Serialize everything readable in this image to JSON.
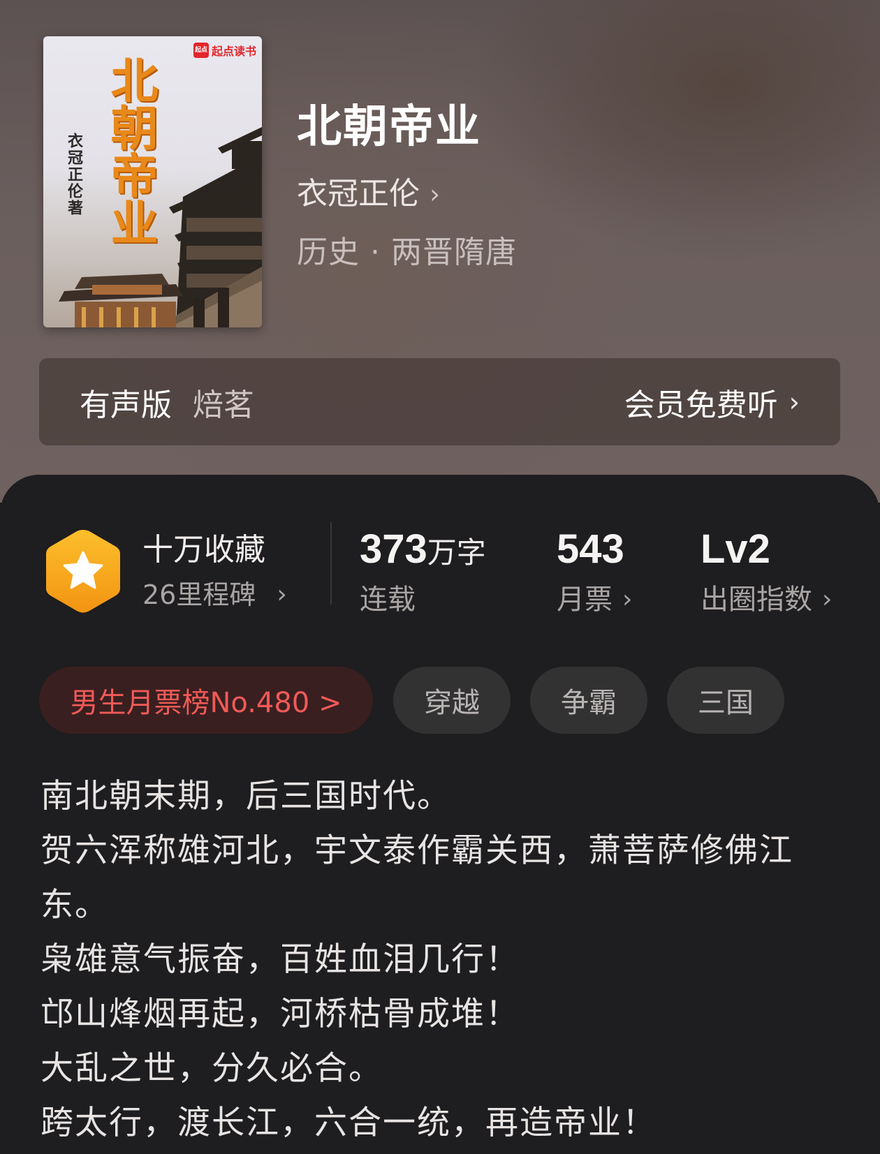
{
  "cover": {
    "publisher": "起点读书",
    "publisher_mark": "起点",
    "title_art": "北朝帝业",
    "author_art": "衣冠正伦著"
  },
  "book": {
    "title": "北朝帝业",
    "author": "衣冠正伦",
    "category": "历史 · 两晋隋唐"
  },
  "audio": {
    "label": "有声版",
    "narrator": "焙茗",
    "action": "会员免费听"
  },
  "stats": {
    "favorites": "十万收藏",
    "milestones": "26里程碑",
    "word_count": "373",
    "word_unit": "万字",
    "status": "连载",
    "monthly_votes": "543",
    "monthly_votes_label": "月票",
    "level": "Lv2",
    "level_label": "出圈指数"
  },
  "tags": [
    {
      "label": "男生月票榜No.480 >"
    },
    {
      "label": "穿越"
    },
    {
      "label": "争霸"
    },
    {
      "label": "三国"
    }
  ],
  "synopsis": [
    "南北朝末期，后三国时代。",
    "贺六浑称雄河北，宇文泰作霸关西，萧菩萨修佛江东。",
    "枭雄意气振奋，百姓血泪几行！",
    "邙山烽烟再起，河桥枯骨成堆！",
    "大乱之世，分久必合。",
    "跨太行，渡长江，六合一统，再造帝业！"
  ],
  "colors": {
    "accent_rank": "#f05a57",
    "badge_orange": "#f7a418",
    "panel_bg": "#1e1d1f"
  },
  "icons": {
    "chevron": "chevron-right-icon",
    "badge": "star-hexagon-icon"
  }
}
